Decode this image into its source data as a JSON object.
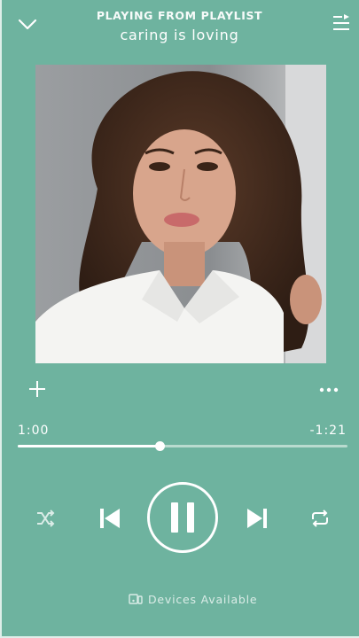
{
  "header": {
    "context_label": "PLAYING FROM PLAYLIST",
    "context_name": "caring is loving"
  },
  "player": {
    "elapsed": "1:00",
    "remaining": "-1:21",
    "progress_fraction": 0.43,
    "state": "playing"
  },
  "devices": {
    "label": "Devices Available"
  },
  "colors": {
    "background": "#6eb39f",
    "foreground": "#ffffff",
    "track_background": "#b9dbcf"
  },
  "icons": {
    "collapse": "chevron-down-icon",
    "queue": "queue-icon",
    "add": "plus-icon",
    "more": "more-horizontal-icon",
    "shuffle": "shuffle-icon",
    "previous": "skip-previous-icon",
    "play_pause": "pause-icon",
    "next": "skip-next-icon",
    "repeat": "repeat-icon",
    "devices": "devices-icon"
  }
}
